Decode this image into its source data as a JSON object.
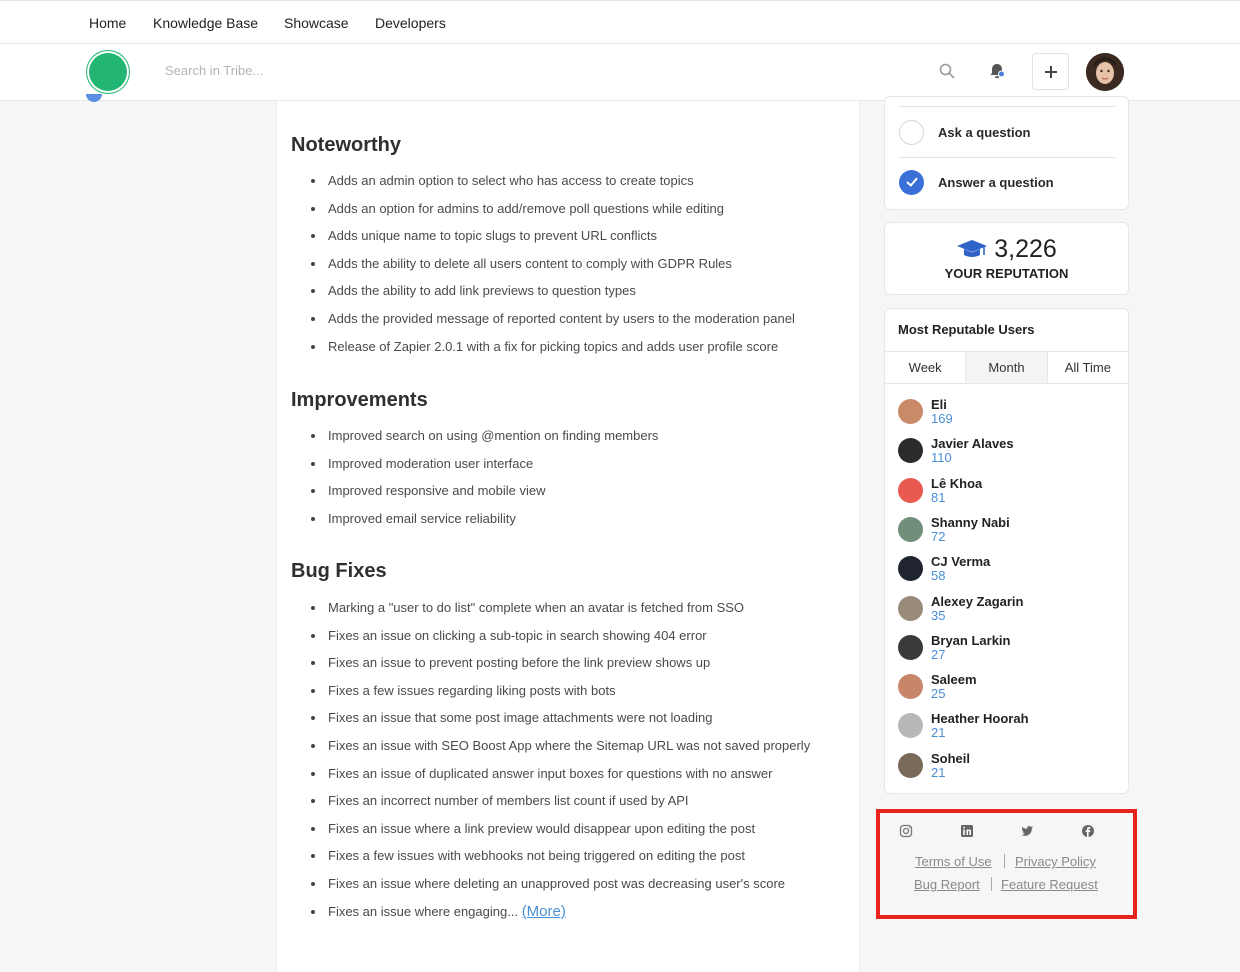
{
  "nav": {
    "items": [
      {
        "label": "Home",
        "name": "nav-home"
      },
      {
        "label": "Knowledge Base",
        "name": "nav-knowledge-base"
      },
      {
        "label": "Showcase",
        "name": "nav-showcase"
      },
      {
        "label": "Developers",
        "name": "nav-developers"
      }
    ]
  },
  "header": {
    "search_placeholder": "Search in Tribe...",
    "icons": {
      "search": "search-icon",
      "notifications": "bell-icon",
      "add": "plus-icon"
    }
  },
  "main": {
    "sections": [
      {
        "title": "Noteworthy",
        "items": [
          "Adds an admin option to select who has access to create topics",
          "Adds an option for admins to add/remove poll questions while editing",
          "Adds unique name to topic slugs to prevent URL conflicts",
          "Adds the ability to delete all users content to comply with GDPR Rules",
          "Adds the ability to add link previews to question types",
          "Adds the provided message of reported content by users to the moderation panel",
          "Release of Zapier 2.0.1 with a fix for picking topics and adds user profile score"
        ]
      },
      {
        "title": "Improvements",
        "items": [
          "Improved search on using @mention on finding members",
          "Improved moderation user interface",
          "Improved responsive and mobile view",
          "Improved email service reliability"
        ]
      },
      {
        "title": "Bug Fixes",
        "items": [
          "Marking a \"user to do list\" complete when an avatar is fetched from SSO",
          "Fixes an issue on clicking a sub-topic in search showing 404 error",
          "Fixes an issue to prevent posting before the link preview shows up",
          "Fixes a few issues regarding liking posts with bots",
          "Fixes an issue that some post image attachments were not loading",
          "Fixes an issue with SEO Boost App where the Sitemap URL was not saved properly",
          "Fixes an issue of duplicated answer input boxes for questions with no answer",
          "Fixes an incorrect number of members list count if used by API",
          "Fixes an issue where a link preview would disappear upon editing the post",
          "Fixes a few issues with webhooks not being triggered on editing the post",
          "Fixes an issue where deleting an unapproved post was decreasing user's score",
          "Fixes an issue where engaging..."
        ],
        "more_label": "(More)"
      }
    ]
  },
  "sidebar": {
    "tasks": [
      {
        "label": "Ask a question",
        "done": false
      },
      {
        "label": "Answer a question",
        "done": true
      }
    ],
    "reputation": {
      "value": "3,226",
      "label": "YOUR REPUTATION",
      "icon": "graduation-cap-icon"
    },
    "most_reputable": {
      "title": "Most Reputable Users",
      "tabs": [
        "Week",
        "Month",
        "All Time"
      ],
      "active_tab": "Month",
      "users": [
        {
          "name": "Eli",
          "score": "169",
          "color": "#c98a6a"
        },
        {
          "name": "Javier Alaves",
          "score": "110",
          "color": "#2b2b2b"
        },
        {
          "name": "Lê Khoa",
          "score": "81",
          "color": "#e85a4f"
        },
        {
          "name": "Shanny Nabi",
          "score": "72",
          "color": "#6f8f7a"
        },
        {
          "name": "CJ Verma",
          "score": "58",
          "color": "#1f2430"
        },
        {
          "name": "Alexey Zagarin",
          "score": "35",
          "color": "#9a8a7a"
        },
        {
          "name": "Bryan Larkin",
          "score": "27",
          "color": "#3a3a3a"
        },
        {
          "name": "Saleem",
          "score": "25",
          "color": "#c7866a"
        },
        {
          "name": "Heather Hoorah",
          "score": "21",
          "color": "#b8b8b8"
        },
        {
          "name": "Soheil",
          "score": "21",
          "color": "#7a6a5a"
        }
      ]
    }
  },
  "footer": {
    "social_icons": [
      "instagram-icon",
      "linkedin-icon",
      "twitter-icon",
      "facebook-icon"
    ],
    "links": [
      {
        "label": "Terms of Use",
        "name": "terms-of-use-link"
      },
      {
        "label": "Privacy Policy",
        "name": "privacy-policy-link"
      },
      {
        "label": "Bug Report",
        "name": "bug-report-link"
      },
      {
        "label": "Feature Request",
        "name": "feature-request-link"
      }
    ],
    "highlight_color": "#e8231c"
  },
  "colors": {
    "accent_blue": "#3a6fd8",
    "link_blue": "#4a8fd6",
    "logo_green": "#22b573"
  }
}
